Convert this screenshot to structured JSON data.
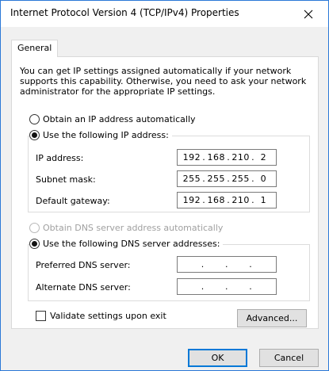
{
  "window": {
    "title": "Internet Protocol Version 4 (TCP/IPv4) Properties",
    "close_icon": "close-icon"
  },
  "tabs": [
    {
      "label": "General",
      "selected": true
    }
  ],
  "description": "You can get IP settings assigned automatically if your network supports this capability. Otherwise, you need to ask your network administrator for the appropriate IP settings.",
  "ip": {
    "auto_label": "Obtain an IP address automatically",
    "auto_selected": false,
    "manual_label": "Use the following IP address:",
    "manual_selected": true,
    "fields": [
      {
        "label": "IP address:",
        "octets": [
          "192",
          "168",
          "210",
          "2"
        ]
      },
      {
        "label": "Subnet mask:",
        "octets": [
          "255",
          "255",
          "255",
          "0"
        ]
      },
      {
        "label": "Default gateway:",
        "octets": [
          "192",
          "168",
          "210",
          "1"
        ]
      }
    ]
  },
  "dns": {
    "auto_label": "Obtain DNS server address automatically",
    "auto_selected": false,
    "auto_disabled": true,
    "manual_label": "Use the following DNS server addresses:",
    "manual_selected": true,
    "fields": [
      {
        "label": "Preferred DNS server:",
        "octets": [
          "",
          "",
          "",
          ""
        ]
      },
      {
        "label": "Alternate DNS server:",
        "octets": [
          "",
          "",
          "",
          ""
        ]
      }
    ]
  },
  "validate": {
    "label": "Validate settings upon exit",
    "checked": false
  },
  "buttons": {
    "advanced": "Advanced...",
    "ok": "OK",
    "cancel": "Cancel"
  },
  "colors": {
    "accent": "#0078d7",
    "window_border": "#2b79d7",
    "dialog_bg": "#f0f0f0"
  }
}
